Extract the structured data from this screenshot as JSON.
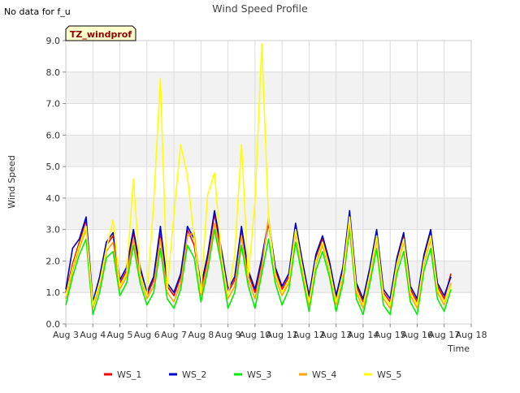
{
  "notice": "No data for f_u",
  "chart_data": {
    "type": "line",
    "title": "Wind Speed Profile",
    "xlabel": "Time",
    "ylabel": "Wind Speed",
    "tag": "TZ_windprof",
    "ylim": [
      0.0,
      9.0
    ],
    "yticks": [
      "0.0",
      "1.0",
      "2.0",
      "3.0",
      "4.0",
      "5.0",
      "6.0",
      "7.0",
      "8.0",
      "9.0"
    ],
    "xlim": [
      "Aug 3",
      "Aug 18"
    ],
    "xticks": [
      "Aug 3",
      "Aug 4",
      "Aug 5",
      "Aug 6",
      "Aug 7",
      "Aug 8",
      "Aug 9",
      "Aug 10",
      "Aug 11",
      "Aug 12",
      "Aug 13",
      "Aug 14",
      "Aug 15",
      "Aug 16",
      "Aug 17",
      "Aug 18"
    ],
    "grid": true,
    "legend_position": "bottom",
    "x": [
      "Aug 3 00:00",
      "Aug 3 06:00",
      "Aug 3 12:00",
      "Aug 3 18:00",
      "Aug 4 00:00",
      "Aug 4 06:00",
      "Aug 4 12:00",
      "Aug 4 18:00",
      "Aug 5 00:00",
      "Aug 5 06:00",
      "Aug 5 12:00",
      "Aug 5 18:00",
      "Aug 6 00:00",
      "Aug 6 06:00",
      "Aug 6 12:00",
      "Aug 6 18:00",
      "Aug 7 00:00",
      "Aug 7 06:00",
      "Aug 7 12:00",
      "Aug 7 18:00",
      "Aug 8 00:00",
      "Aug 8 06:00",
      "Aug 8 12:00",
      "Aug 8 18:00",
      "Aug 9 00:00",
      "Aug 9 06:00",
      "Aug 9 12:00",
      "Aug 9 18:00",
      "Aug 10 00:00",
      "Aug 10 06:00",
      "Aug 10 12:00",
      "Aug 10 18:00",
      "Aug 11 00:00",
      "Aug 11 06:00",
      "Aug 11 12:00",
      "Aug 11 18:00",
      "Aug 12 00:00",
      "Aug 12 06:00",
      "Aug 12 12:00",
      "Aug 12 18:00",
      "Aug 13 00:00",
      "Aug 13 06:00",
      "Aug 13 12:00",
      "Aug 13 18:00",
      "Aug 14 00:00",
      "Aug 14 06:00",
      "Aug 14 12:00",
      "Aug 14 18:00",
      "Aug 15 00:00",
      "Aug 15 06:00",
      "Aug 15 12:00",
      "Aug 15 18:00",
      "Aug 16 00:00",
      "Aug 16 06:00",
      "Aug 16 12:00",
      "Aug 16 18:00",
      "Aug 17 00:00",
      "Aug 17 06:00"
    ],
    "series": [
      {
        "name": "WS_1",
        "color": "#ff0000",
        "values": [
          1.0,
          1.9,
          2.6,
          3.3,
          0.6,
          1.3,
          2.5,
          2.8,
          1.3,
          1.7,
          2.9,
          1.7,
          0.9,
          1.4,
          2.9,
          1.2,
          0.9,
          1.5,
          3.0,
          2.5,
          1.1,
          2.1,
          3.5,
          2.3,
          1.0,
          1.4,
          3.0,
          1.6,
          1.0,
          2.0,
          3.2,
          1.7,
          1.1,
          1.5,
          3.1,
          1.9,
          0.8,
          2.1,
          2.7,
          1.9,
          0.8,
          1.7,
          3.5,
          1.2,
          0.7,
          1.7,
          2.9,
          1.0,
          0.7,
          2.0,
          2.8,
          1.1,
          0.7,
          2.1,
          2.9,
          1.2,
          0.8,
          1.6
        ]
      },
      {
        "name": "WS_2",
        "color": "#0000cc",
        "values": [
          1.1,
          2.4,
          2.7,
          3.4,
          0.7,
          1.5,
          2.6,
          2.9,
          1.4,
          1.8,
          3.0,
          1.8,
          1.0,
          1.5,
          3.1,
          1.3,
          1.0,
          1.6,
          3.1,
          2.7,
          1.2,
          2.2,
          3.6,
          2.4,
          1.1,
          1.5,
          3.1,
          1.7,
          1.1,
          2.1,
          3.3,
          1.8,
          1.2,
          1.6,
          3.2,
          2.0,
          0.9,
          2.2,
          2.8,
          2.0,
          0.9,
          1.8,
          3.6,
          1.3,
          0.8,
          1.8,
          3.0,
          1.1,
          0.8,
          2.1,
          2.9,
          1.2,
          0.8,
          2.2,
          3.0,
          1.3,
          0.9,
          1.5
        ]
      },
      {
        "name": "WS_3",
        "color": "#00ee00",
        "values": [
          0.6,
          1.5,
          2.2,
          2.7,
          0.3,
          1.0,
          2.1,
          2.3,
          0.9,
          1.3,
          2.5,
          1.3,
          0.6,
          1.0,
          2.4,
          0.8,
          0.5,
          1.1,
          2.5,
          2.1,
          0.7,
          1.7,
          3.0,
          1.9,
          0.5,
          1.0,
          2.5,
          1.2,
          0.5,
          1.6,
          2.7,
          1.3,
          0.6,
          1.1,
          2.6,
          1.5,
          0.4,
          1.7,
          2.3,
          1.5,
          0.4,
          1.3,
          3.0,
          0.8,
          0.3,
          1.3,
          2.4,
          0.6,
          0.3,
          1.6,
          2.3,
          0.7,
          0.3,
          1.7,
          2.4,
          0.8,
          0.4,
          1.1
        ]
      },
      {
        "name": "WS_4",
        "color": "#ffa500",
        "values": [
          0.8,
          1.7,
          2.4,
          3.0,
          0.5,
          1.2,
          2.3,
          2.6,
          1.1,
          1.5,
          2.7,
          1.5,
          0.8,
          1.2,
          2.7,
          1.0,
          0.7,
          1.3,
          2.8,
          2.9,
          0.9,
          1.9,
          3.2,
          2.1,
          0.8,
          1.2,
          2.8,
          1.4,
          0.8,
          1.8,
          3.4,
          1.5,
          0.9,
          1.3,
          2.9,
          1.7,
          0.6,
          1.9,
          2.5,
          1.7,
          0.6,
          1.5,
          3.2,
          1.0,
          0.5,
          1.5,
          2.7,
          0.8,
          0.5,
          1.8,
          2.6,
          0.9,
          0.5,
          1.9,
          2.7,
          1.0,
          0.6,
          1.3
        ]
      },
      {
        "name": "WS_5",
        "color": "#ffff00",
        "values": [
          0.9,
          1.8,
          2.5,
          3.1,
          0.6,
          1.3,
          2.4,
          3.3,
          1.2,
          1.6,
          4.6,
          1.6,
          0.9,
          3.8,
          7.8,
          1.1,
          3.5,
          5.7,
          4.7,
          2.7,
          1.0,
          4.1,
          4.8,
          2.2,
          0.9,
          2.2,
          5.7,
          1.5,
          3.9,
          8.9,
          3.3,
          1.6,
          1.0,
          1.4,
          3.0,
          1.8,
          0.7,
          2.0,
          2.6,
          1.8,
          0.7,
          1.6,
          3.4,
          1.1,
          0.6,
          1.6,
          2.8,
          0.9,
          0.6,
          1.9,
          2.7,
          1.0,
          0.6,
          2.0,
          2.8,
          1.1,
          0.7,
          1.2
        ]
      }
    ]
  }
}
